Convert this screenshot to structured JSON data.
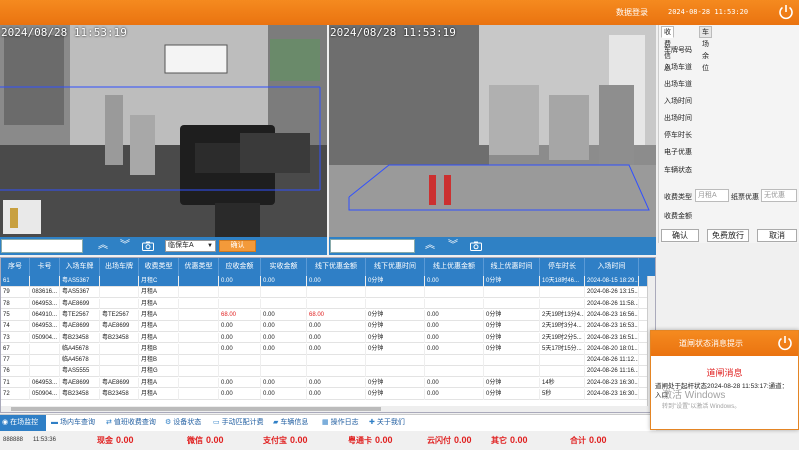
{
  "topbar": {
    "user": "数据登录",
    "datetime": "2024-08-28  11:53:20"
  },
  "cameras": [
    {
      "timestamp": "2024/08/28 11:53:19"
    },
    {
      "timestamp": "2024/08/28 11:53:19"
    }
  ],
  "controls": {
    "vehicle_type": "临保车A",
    "confirm": "确认"
  },
  "right_panel": {
    "tabs": [
      "收费信息",
      "车场余位"
    ],
    "fields": [
      "车牌号码",
      "入场车道",
      "出场车道",
      "入场时间",
      "出场时间",
      "停车时长",
      "电子优惠",
      "车辆状态"
    ],
    "fee_type_label": "收费类型",
    "fee_type_value": "月租A",
    "discount_label": "纸票优惠",
    "discount_value": "无优惠",
    "amount_label": "收费金额",
    "buttons": [
      "确认",
      "免费放行",
      "取消"
    ]
  },
  "table": {
    "columns": [
      "序号",
      "卡号",
      "入场车牌",
      "出场车牌",
      "收费类型",
      "优惠类型",
      "应收金额",
      "实收金额",
      "线下优惠金额",
      "线下优惠时间",
      "线上优惠金额",
      "线上优惠时间",
      "停车时长",
      "入场时间"
    ],
    "rows": [
      [
        "61",
        "",
        "粤AS5367",
        "",
        "月租C",
        "",
        "0.00",
        "0.00",
        "0.00",
        "0分钟",
        "0.00",
        "0分钟",
        "10天18时46...",
        "2024-08-15 18:29..."
      ],
      [
        "79",
        "083616...",
        "粤AS5367",
        "",
        "月租A",
        "",
        "",
        "",
        "",
        "",
        "",
        "",
        "",
        "2024-08-26 13:15..."
      ],
      [
        "78",
        "064953...",
        "粤AE8699",
        "",
        "月租A",
        "",
        "",
        "",
        "",
        "",
        "",
        "",
        "",
        "2024-08-26 11:58..."
      ],
      [
        "75",
        "064910...",
        "粤TE2567",
        "粤TE2567",
        "月租A",
        "",
        "68.00",
        "0.00",
        "68.00",
        "0分钟",
        "0.00",
        "0分钟",
        "2天19时13分4...",
        "2024-08-23 16:56..."
      ],
      [
        "74",
        "064953...",
        "粤AE8699",
        "粤AE8699",
        "月租A",
        "",
        "0.00",
        "0.00",
        "0.00",
        "0分钟",
        "0.00",
        "0分钟",
        "2天19时3分4...",
        "2024-08-23 16:53..."
      ],
      [
        "73",
        "050904...",
        "粤B23458",
        "粤B23458",
        "月租A",
        "",
        "0.00",
        "0.00",
        "0.00",
        "0分钟",
        "0.00",
        "0分钟",
        "2天19时2分5...",
        "2024-08-23 16:51..."
      ],
      [
        "67",
        "",
        "临A45678",
        "",
        "月租B",
        "",
        "0.00",
        "0.00",
        "0.00",
        "0分钟",
        "0.00",
        "0分钟",
        "5天17时15分...",
        "2024-08-20 18:01..."
      ],
      [
        "77",
        "",
        "临A45678",
        "",
        "月租B",
        "",
        "",
        "",
        "",
        "",
        "",
        "",
        "",
        "2024-08-26 11:12..."
      ],
      [
        "76",
        "",
        "粤AS5555",
        "",
        "月租G",
        "",
        "",
        "",
        "",
        "",
        "",
        "",
        "",
        "2024-08-26 11:16..."
      ],
      [
        "71",
        "064953...",
        "粤AE8699",
        "粤AE8699",
        "月租A",
        "",
        "0.00",
        "0.00",
        "0.00",
        "0分钟",
        "0.00",
        "0分钟",
        "14秒",
        "2024-08-23 16:30..."
      ],
      [
        "72",
        "050904...",
        "粤B23458",
        "粤B23458",
        "月租A",
        "",
        "0.00",
        "0.00",
        "0.00",
        "0分钟",
        "0.00",
        "0分钟",
        "5秒",
        "2024-08-23 16:30..."
      ]
    ]
  },
  "nav": [
    "在场监控",
    "场内车查询",
    "值班收费查询",
    "设备状态",
    "手动匹配计费",
    "车辆信息",
    "操作日志",
    "关于我们"
  ],
  "summary": {
    "counter": "888888",
    "time": "11:53:36",
    "items": [
      {
        "label": "现金",
        "value": "0.00"
      },
      {
        "label": "微信",
        "value": "0.00"
      },
      {
        "label": "支付宝",
        "value": "0.00"
      },
      {
        "label": "粤通卡",
        "value": "0.00"
      },
      {
        "label": "云闪付",
        "value": "0.00"
      },
      {
        "label": "其它",
        "value": "0.00"
      },
      {
        "label": "合计",
        "value": "0.00"
      }
    ]
  },
  "popup": {
    "header": "道闸状态消息提示",
    "title": "道闸消息",
    "message": "道闸处于起杆状态2024-08-28 11:53:17:通道：入口",
    "watermark_title": "激活 Windows",
    "watermark_sub": "转到\"设置\"以激活 Windows。"
  },
  "colors": {
    "accent": "#f08020",
    "primary": "#2f7fc6",
    "red": "#e02020"
  }
}
